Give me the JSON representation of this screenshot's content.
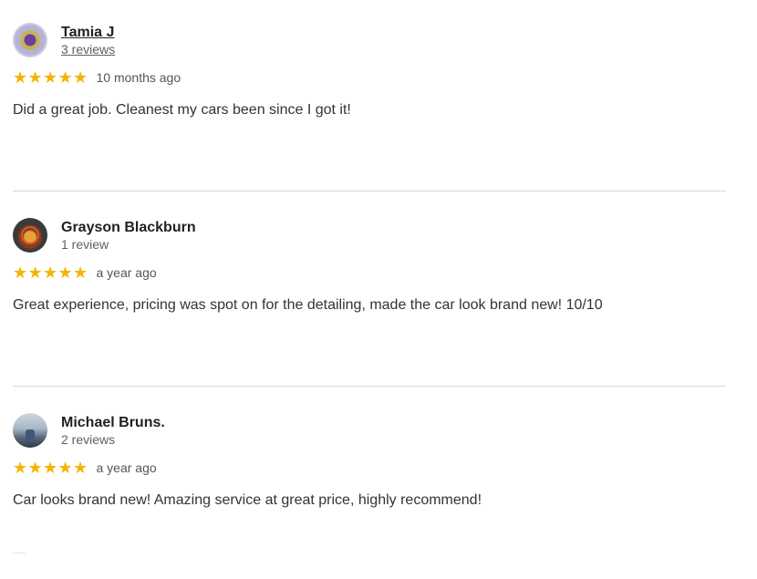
{
  "reviews": [
    {
      "author": "Tamia J",
      "review_count": "3 reviews",
      "rating": 5,
      "time": "10 months ago",
      "text": "Did a great job. Cleanest my cars been since I got it!"
    },
    {
      "author": "Grayson Blackburn",
      "review_count": "1 review",
      "rating": 5,
      "time": "a year ago",
      "text": "Great experience, pricing was spot on for the detailing, made the car look brand new! 10/10"
    },
    {
      "author": "Michael Bruns.",
      "review_count": "2 reviews",
      "rating": 5,
      "time": "a year ago",
      "text": "Car looks brand new! Amazing service at great price, highly recommend!"
    }
  ],
  "colors": {
    "star": "#f4b400",
    "divider": "#d6d6d6"
  },
  "icons": {
    "star": "star-icon"
  }
}
